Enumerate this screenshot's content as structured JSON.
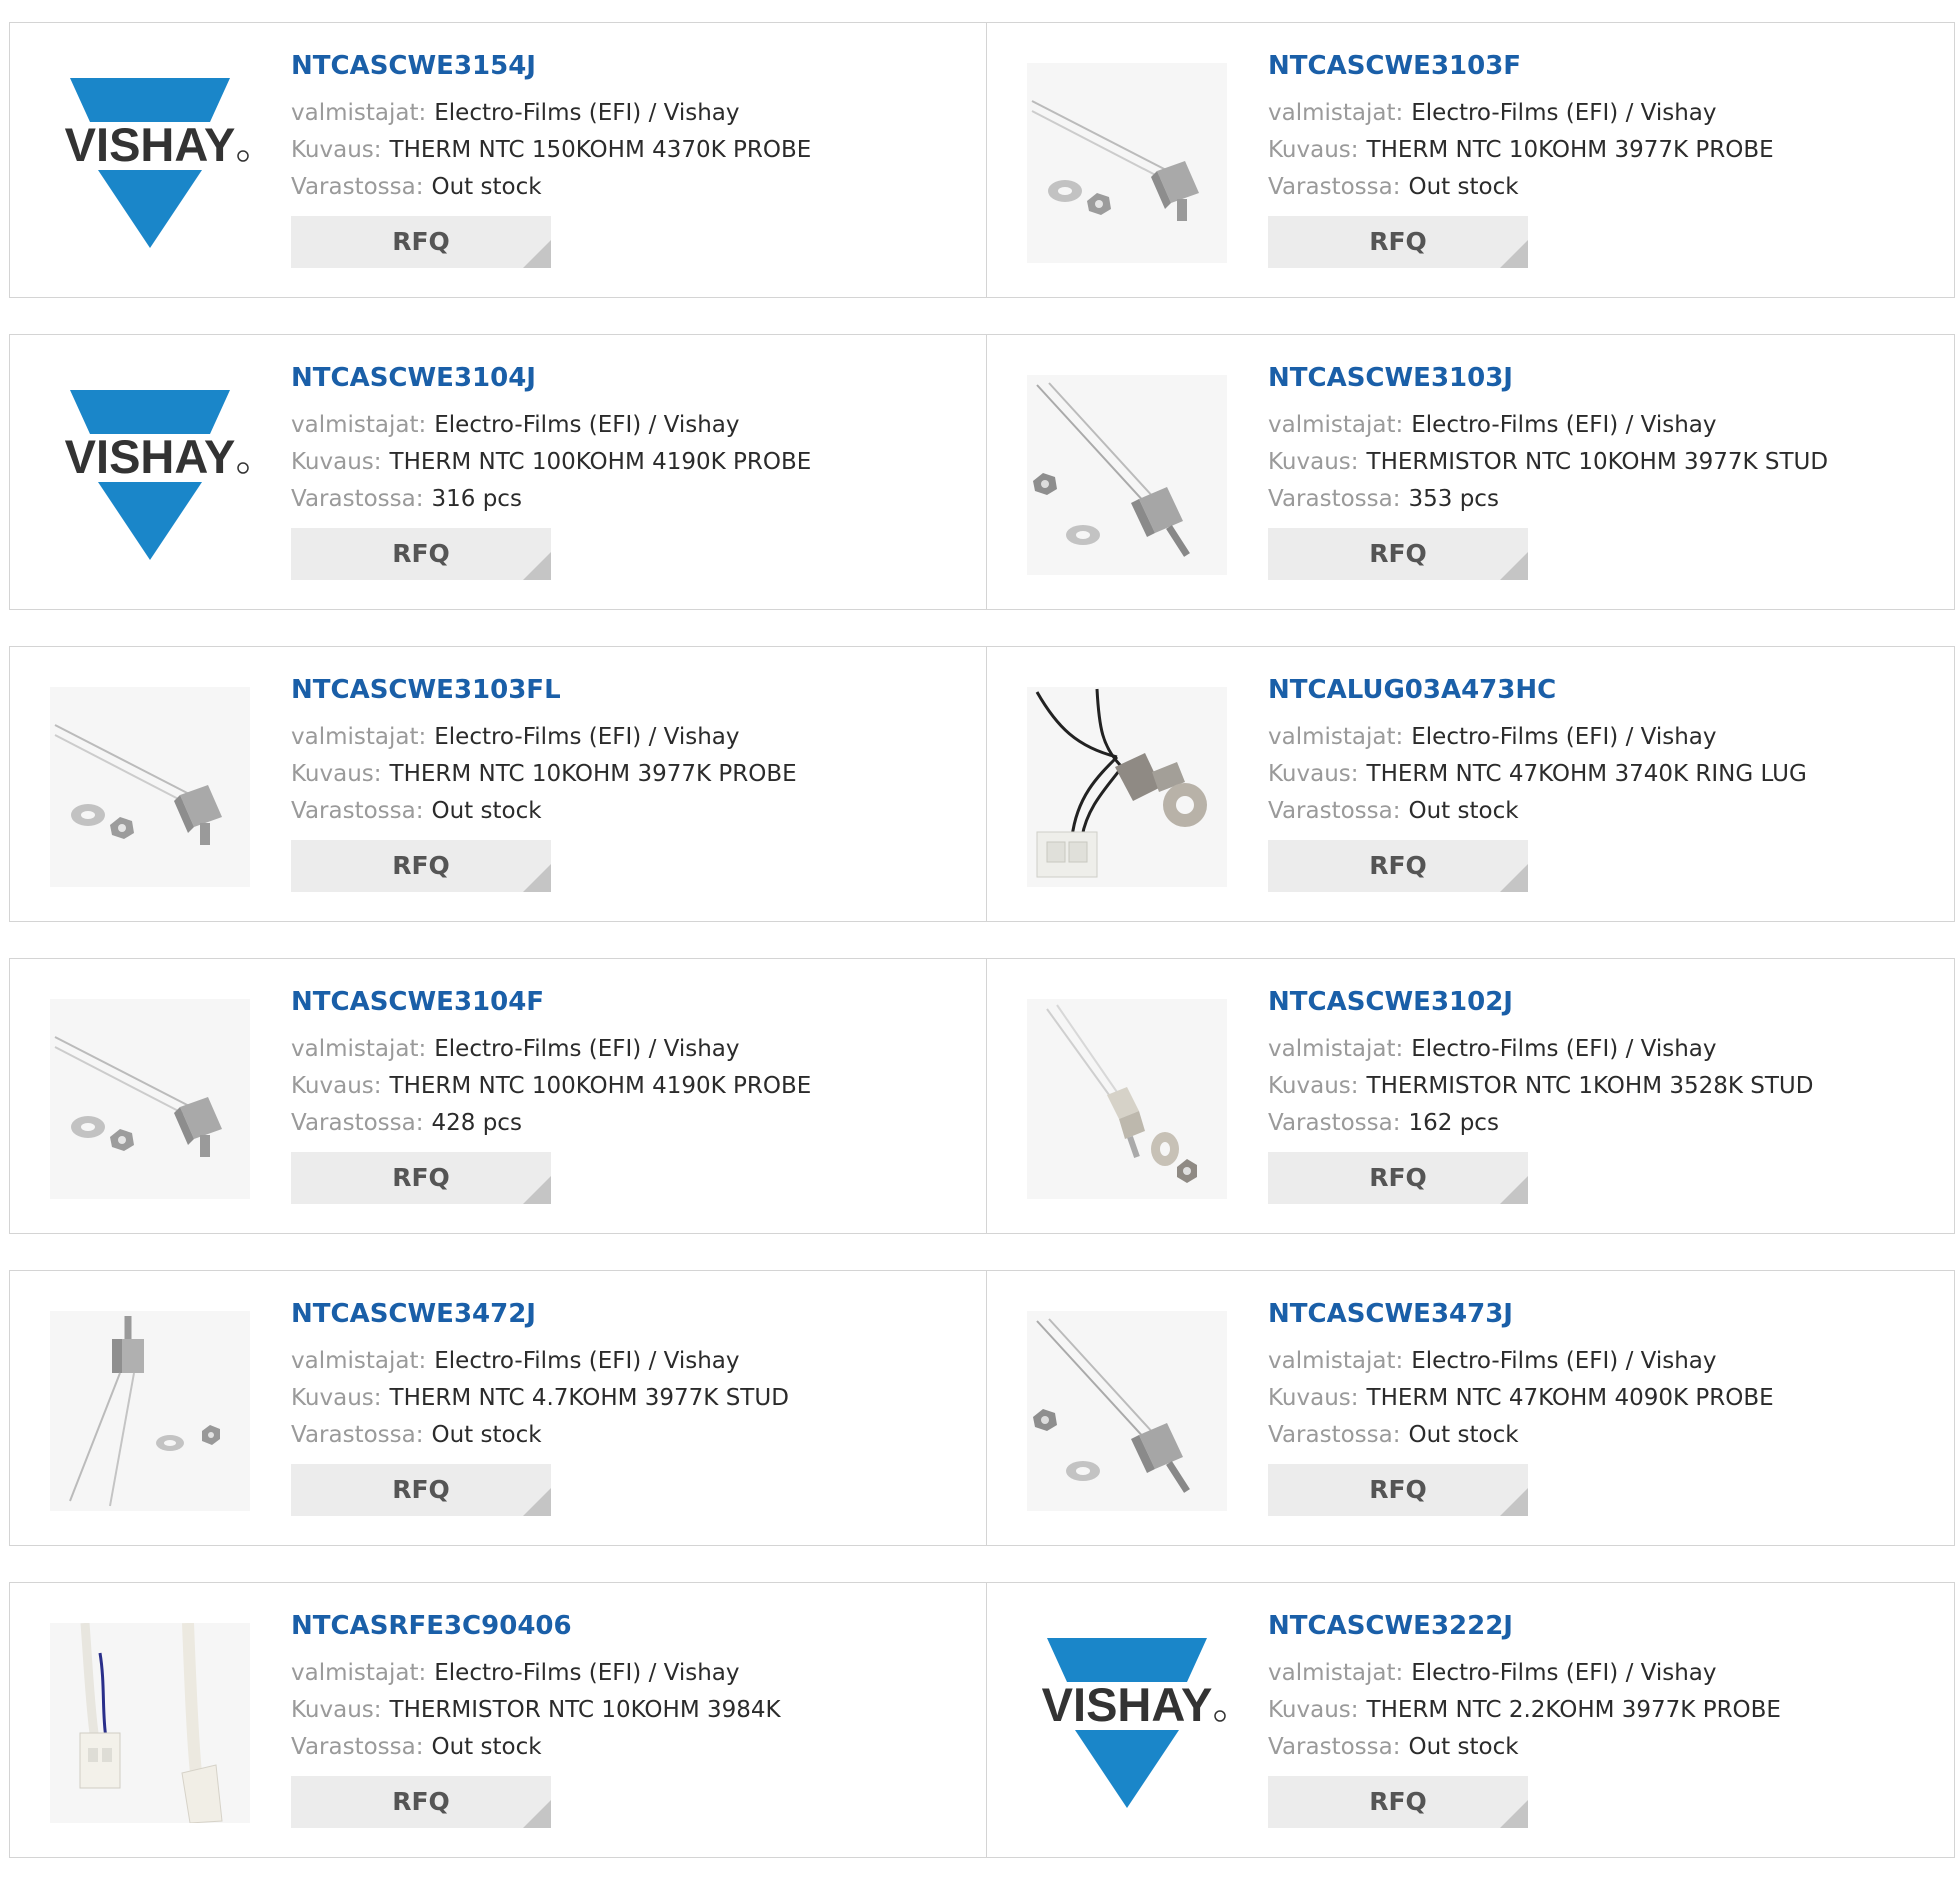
{
  "labels": {
    "manufacturer": "valmistajat:",
    "description": "Kuvaus:",
    "stock": "Varastossa:",
    "rfq": "RFQ",
    "logo_text": "VISHAY"
  },
  "colors": {
    "part_link": "#1a5fa8",
    "vishay_blue": "#1a86c9",
    "label_gray": "#9a9a9a",
    "button_bg": "#ececec"
  },
  "products": [
    {
      "part": "NTCASCWE3154J",
      "manufacturer": "Electro-Films (EFI) / Vishay",
      "description": "THERM NTC 150KOHM 4370K PROBE",
      "stock": "Out stock",
      "image": "vishay-logo"
    },
    {
      "part": "NTCASCWE3103F",
      "manufacturer": "Electro-Films (EFI) / Vishay",
      "description": "THERM NTC 10KOHM 3977K PROBE",
      "stock": "Out stock",
      "image": "probe-photo"
    },
    {
      "part": "NTCASCWE3104J",
      "manufacturer": "Electro-Films (EFI) / Vishay",
      "description": "THERM NTC 100KOHM 4190K PROBE",
      "stock": "316 pcs",
      "image": "vishay-logo"
    },
    {
      "part": "NTCASCWE3103J",
      "manufacturer": "Electro-Films (EFI) / Vishay",
      "description": "THERMISTOR NTC 10KOHM 3977K STUD",
      "stock": "353 pcs",
      "image": "stud-photo"
    },
    {
      "part": "NTCASCWE3103FL",
      "manufacturer": "Electro-Films (EFI) / Vishay",
      "description": "THERM NTC 10KOHM 3977K PROBE",
      "stock": "Out stock",
      "image": "probe-photo"
    },
    {
      "part": "NTCALUG03A473HC",
      "manufacturer": "Electro-Films (EFI) / Vishay",
      "description": "THERM NTC 47KOHM 3740K RING LUG",
      "stock": "Out stock",
      "image": "ring-lug-photo"
    },
    {
      "part": "NTCASCWE3104F",
      "manufacturer": "Electro-Films (EFI) / Vishay",
      "description": "THERM NTC 100KOHM 4190K PROBE",
      "stock": "428 pcs",
      "image": "probe-photo"
    },
    {
      "part": "NTCASCWE3102J",
      "manufacturer": "Electro-Films (EFI) / Vishay",
      "description": "THERMISTOR NTC 1KOHM 3528K STUD",
      "stock": "162 pcs",
      "image": "stud-vertical-photo"
    },
    {
      "part": "NTCASCWE3472J",
      "manufacturer": "Electro-Films (EFI) / Vishay",
      "description": "THERM NTC 4.7KOHM 3977K STUD",
      "stock": "Out stock",
      "image": "stud-upright-photo"
    },
    {
      "part": "NTCASCWE3473J",
      "manufacturer": "Electro-Films (EFI) / Vishay",
      "description": "THERM NTC 47KOHM 4090K PROBE",
      "stock": "Out stock",
      "image": "stud-photo"
    },
    {
      "part": "NTCASRFE3C90406",
      "manufacturer": "Electro-Films (EFI) / Vishay",
      "description": "THERMISTOR NTC 10KOHM 3984K",
      "stock": "Out stock",
      "image": "cable-connector-photo"
    },
    {
      "part": "NTCASCWE3222J",
      "manufacturer": "Electro-Films (EFI) / Vishay",
      "description": "THERM NTC 2.2KOHM 3977K PROBE",
      "stock": "Out stock",
      "image": "vishay-logo"
    }
  ]
}
